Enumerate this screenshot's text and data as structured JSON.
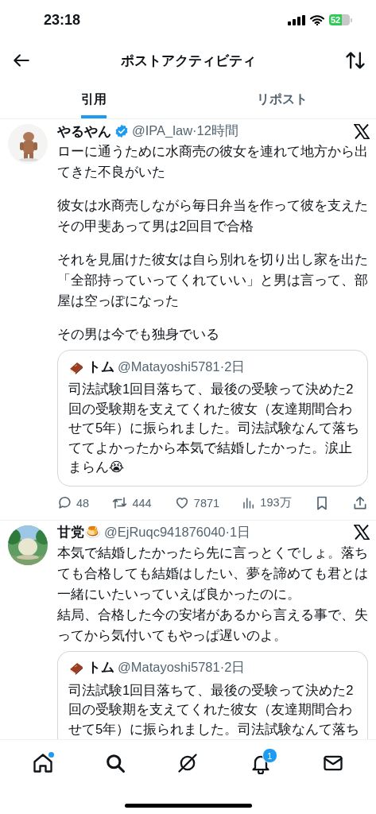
{
  "status_bar": {
    "time": "23:18",
    "battery": "52"
  },
  "header": {
    "title": "ポストアクティビティ"
  },
  "tabs": [
    {
      "label": "引用",
      "selected": true
    },
    {
      "label": "リポスト",
      "selected": false
    }
  ],
  "posts": [
    {
      "name": "やるやん",
      "verified": true,
      "meta": "@IPA_law·12時間",
      "paragraphs": [
        [
          "ローに通うために水商売の彼女を連れて地方から出てきた不良がいた"
        ],
        [
          "彼女は水商売しながら毎日弁当を作って彼を支えた",
          "その甲斐あって男は2回目で合格"
        ],
        [
          "それを見届けた彼女は自ら別れを切り出し家を出た",
          "「全部持っていってくれていい」と男は言って、部屋は空っぽになった"
        ],
        [
          "その男は今でも独身でいる"
        ]
      ],
      "quote": {
        "name": "トム",
        "meta": "@Matayoshi5781·2日",
        "text": "司法試験1回目落ちて、最後の受験って決めた2回の受験期を支えてくれた彼女（友達期間合わせて5年）に振られました。司法試験なんて落ちててよかったから本気で結婚したかった。涙止まらん😭"
      },
      "stats": {
        "replies": "48",
        "reposts": "444",
        "likes": "7871",
        "views": "193万"
      }
    },
    {
      "name": "甘党🍮",
      "verified": false,
      "meta": "@EjRuqc941876040·1日",
      "paragraphs": [
        [
          "本気で結婚したかったら先に言っとくでしょ。落ちても合格しても結婚はしたい、夢を諦めても君とは一緒にいたいっていえば良かったのに。",
          "結局、合格した今の安堵があるから言える事で、失ってから気付いてもやっぱ遅いのよ。"
        ]
      ],
      "quote": {
        "name": "トム",
        "meta": "@Matayoshi5781·2日",
        "text": "司法試験1回目落ちて、最後の受験って決めた2回の受験期を支えてくれた彼女（友達期間合わせて5年）に振られました。司法試験なんて落ち"
      }
    }
  ],
  "nav": [
    {
      "kind": "home",
      "dot": true
    },
    {
      "kind": "search"
    },
    {
      "kind": "grok"
    },
    {
      "kind": "notifications",
      "badge": "1"
    },
    {
      "kind": "messages"
    }
  ]
}
